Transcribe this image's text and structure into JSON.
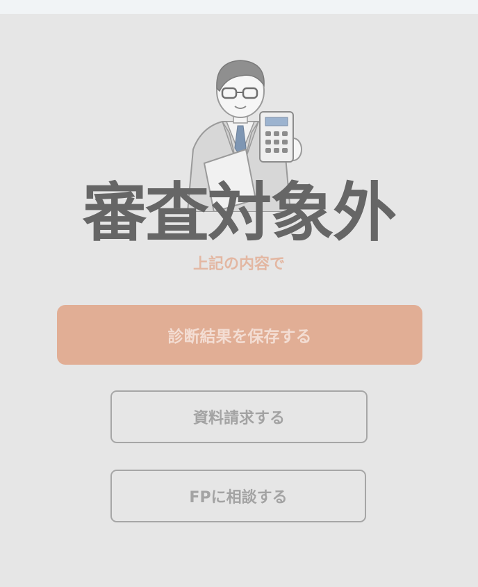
{
  "result": {
    "title": "審査対象外",
    "subtitle": "上記の内容で"
  },
  "actions": {
    "save_label": "診断結果を保存する",
    "request_label": "資料請求する",
    "fp_label": "FPに相談する"
  },
  "colors": {
    "primary": "#e1ae95",
    "title": "#666666",
    "subtitle": "#e3b7a2",
    "outline": "#a6a6a6"
  }
}
